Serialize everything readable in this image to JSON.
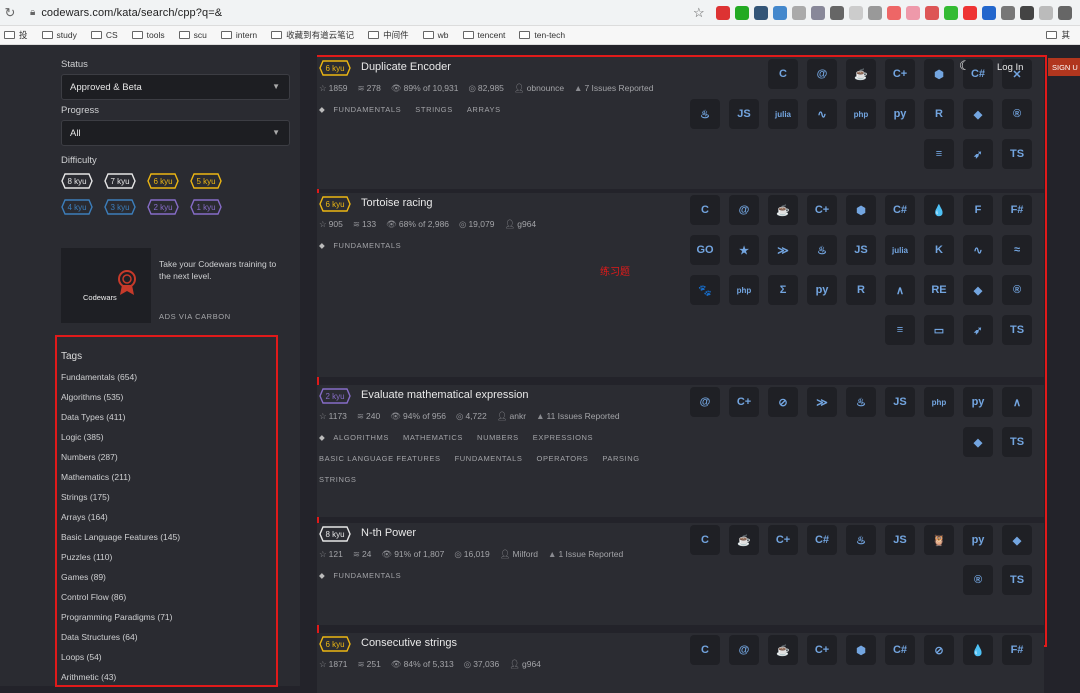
{
  "browser": {
    "url": "codewars.com/kata/search/cpp?q=&",
    "bookmarks": [
      "投",
      "study",
      "CS",
      "tools",
      "scu",
      "intern",
      "收藏到有道云笔记",
      "中间件",
      "wb",
      "tencent",
      "ten-tech",
      "其"
    ]
  },
  "header": {
    "login": "Log In",
    "signup": "SIGN U"
  },
  "sidebar": {
    "status_label": "Status",
    "status_value": "Approved & Beta",
    "progress_label": "Progress",
    "progress_value": "All",
    "difficulty_label": "Difficulty",
    "kyu_row1": [
      {
        "label": "8 kyu",
        "color": "#e6e6e6"
      },
      {
        "label": "7 kyu",
        "color": "#e6e6e6"
      },
      {
        "label": "6 kyu",
        "color": "#ecb613"
      },
      {
        "label": "5 kyu",
        "color": "#ecb613"
      }
    ],
    "kyu_row2": [
      {
        "label": "4 kyu",
        "color": "#3c7ebb"
      },
      {
        "label": "3 kyu",
        "color": "#3c7ebb"
      },
      {
        "label": "2 kyu",
        "color": "#866cc7"
      },
      {
        "label": "1 kyu",
        "color": "#866cc7"
      }
    ],
    "ad": {
      "logo": "Codewars",
      "copy": "Take your Codewars training to the next level.",
      "via": "ADS VIA CARBON"
    },
    "tags_title": "Tags",
    "tags": [
      "Fundamentals (654)",
      "Algorithms (535)",
      "Data Types (411)",
      "Logic (385)",
      "Numbers (287)",
      "Mathematics (211)",
      "Strings (175)",
      "Arrays (164)",
      "Basic Language Features (145)",
      "Puzzles (110)",
      "Games (89)",
      "Control Flow (86)",
      "Programming Paradigms (71)",
      "Data Structures (64)",
      "Loops (54)",
      "Arithmetic (43)"
    ]
  },
  "annotation": "练习题",
  "katas": [
    {
      "rank": "6 kyu",
      "rank_color": "#ecb613",
      "title": "Duplicate Encoder",
      "stars": "1859",
      "collections": "278",
      "satisfaction": "89% of 10,931",
      "completed": "82,985",
      "author": "obnounce",
      "issues": "7 Issues Reported",
      "tags_lines": [
        [
          "FUNDAMENTALS",
          "STRINGS",
          "ARRAYS"
        ]
      ],
      "langs": [
        "C",
        "@",
        "☕",
        "C+",
        "⬢",
        "C#",
        "✕",
        "♨",
        "JS",
        "julia",
        "∿",
        "php",
        "py",
        "R",
        "◆",
        "®",
        "≡",
        "➶",
        "TS"
      ]
    },
    {
      "rank": "6 kyu",
      "rank_color": "#ecb613",
      "title": "Tortoise racing",
      "stars": "905",
      "collections": "133",
      "satisfaction": "68% of 2,986",
      "completed": "19,079",
      "author": "g964",
      "issues": "",
      "tags_lines": [
        [
          "FUNDAMENTALS"
        ]
      ],
      "langs": [
        "C",
        "@",
        "☕",
        "C+",
        "⬢",
        "C#",
        "💧",
        "F",
        "F#",
        "GO",
        "★",
        "≫",
        "♨",
        "JS",
        "julia",
        "K",
        "∿",
        "≈",
        "🐾",
        "php",
        "Σ",
        "py",
        "R",
        "∧",
        "RE",
        "◆",
        "®",
        "≡",
        "▭",
        "➶",
        "TS"
      ]
    },
    {
      "rank": "2 kyu",
      "rank_color": "#866cc7",
      "title": "Evaluate mathematical expression",
      "stars": "1173",
      "collections": "240",
      "satisfaction": "94% of 956",
      "completed": "4,722",
      "author": "ankr",
      "issues": "11 Issues Reported",
      "tags_lines": [
        [
          "ALGORITHMS",
          "MATHEMATICS",
          "NUMBERS",
          "EXPRESSIONS"
        ],
        [
          "BASIC LANGUAGE FEATURES",
          "FUNDAMENTALS",
          "OPERATORS",
          "PARSING"
        ],
        [
          "STRINGS"
        ]
      ],
      "langs": [
        "@",
        "C+",
        "⊘",
        "≫",
        "♨",
        "JS",
        "php",
        "py",
        "∧",
        "◆",
        "TS"
      ]
    },
    {
      "rank": "8 kyu",
      "rank_color": "#e6e6e6",
      "title": "N-th Power",
      "stars": "121",
      "collections": "24",
      "satisfaction": "91% of 1,807",
      "completed": "16,019",
      "author": "Milford",
      "issues": "1 Issue Reported",
      "tags_lines": [
        [
          "FUNDAMENTALS"
        ]
      ],
      "langs": [
        "C",
        "☕",
        "C+",
        "C#",
        "♨",
        "JS",
        "🦉",
        "py",
        "◆",
        "®",
        "TS"
      ]
    },
    {
      "rank": "6 kyu",
      "rank_color": "#ecb613",
      "title": "Consecutive strings",
      "stars": "1871",
      "collections": "251",
      "satisfaction": "84% of 5,313",
      "completed": "37,036",
      "author": "g964",
      "issues": "",
      "tags_lines": [],
      "langs": [
        "C",
        "@",
        "☕",
        "C+",
        "⬢",
        "C#",
        "⊘",
        "💧",
        "F#"
      ]
    }
  ]
}
